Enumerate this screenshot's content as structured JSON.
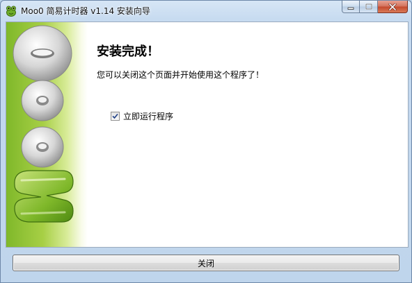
{
  "window": {
    "title": "Moo0 简易计时器 v1.14 安装向导",
    "app_icon": "moo0-frog-icon",
    "caption_buttons": [
      "minimize-icon",
      "maximize-icon",
      "close-icon"
    ]
  },
  "banner": {
    "logo_text": "Moo0",
    "colors": {
      "green_dark": "#6fa81f",
      "green_light": "#c8e27a",
      "silver": "#c9c9c9"
    }
  },
  "content": {
    "heading": "安装完成！",
    "description": "您可以关闭这个页面并开始使用这个程序了！",
    "run_now": {
      "label": "立即运行程序",
      "checked": true
    }
  },
  "footer": {
    "close_label": "关闭"
  }
}
